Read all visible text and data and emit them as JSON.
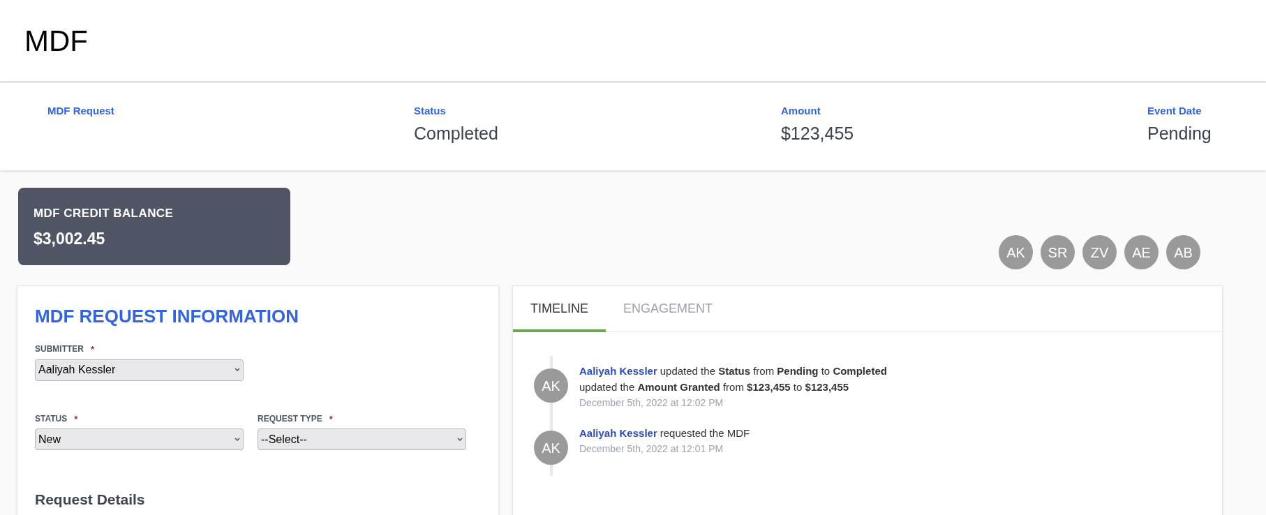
{
  "page_title": "MDF",
  "summary": [
    {
      "label": "MDF Request"
    },
    {
      "label": "Status",
      "value": "Completed"
    },
    {
      "label": "Amount",
      "value": "$123,455"
    },
    {
      "label": "Event Date",
      "value": "Pending"
    }
  ],
  "credit_balance": {
    "label": "MDF CREDIT BALANCE",
    "value": "$3,002.45"
  },
  "participants": [
    "AK",
    "SR",
    "ZV",
    "AE",
    "AB"
  ],
  "request_info": {
    "title": "MDF REQUEST INFORMATION",
    "field_rows": [
      [
        {
          "label": "SUBMITTER",
          "required_mark": "*",
          "value": "Aaliyah Kessler"
        }
      ],
      [
        {
          "label": "STATUS",
          "required_mark": "*",
          "value": "New"
        },
        {
          "label": "REQUEST TYPE",
          "required_mark": "*",
          "value": "--Select--"
        }
      ]
    ],
    "section_heading": "Request Details"
  },
  "tabs": [
    {
      "label": "TIMELINE",
      "selected": true
    },
    {
      "label": "ENGAGEMENT",
      "selected": false
    }
  ],
  "timeline": [
    {
      "initials": "AK",
      "actor": "Aaliyah Kessler",
      "lines": [
        "updated the **Status** from **Pending** to **Completed**",
        "updated the **Amount Granted** from **$123,455** to **$123,455**"
      ],
      "time": "December 5th, 2022 at 12:02 PM"
    },
    {
      "initials": "AK",
      "actor": "Aaliyah Kessler",
      "lines": [
        "requested the MDF"
      ],
      "time": "December 5th, 2022 at 12:01 PM"
    }
  ]
}
